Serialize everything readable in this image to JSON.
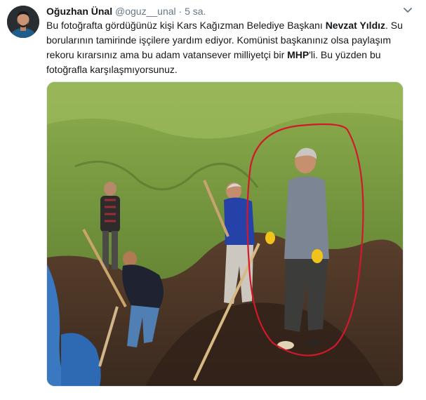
{
  "tweet": {
    "author_name": "Oğuzhan Ünal",
    "author_handle": "@oguz__unal",
    "separator": "·",
    "timestamp": "5 sa.",
    "text_parts": {
      "p1": "Bu fotoğrafta gördüğünüz kişi Kars Kağızman Belediye Başkanı ",
      "b1": "Nevzat Yıldız",
      "p2": ". Su borularının tamirinde işçilere yardım ediyor. Komünist başkanınız olsa paylaşım rekoru kırarsınız ama bu adam vatansever milliyetçi bir ",
      "b2": "MHP",
      "p3": "'li. Bu yüzden bu fotoğrafla karşılaşmıyorsunuz."
    },
    "menu_icon": "chevron-down-icon",
    "avatar_icon": "user-avatar",
    "media_description_icon": "photo"
  },
  "colors": {
    "secondary_text": "#657786",
    "primary_text": "#14171a",
    "circle_annotation": "#d3182b"
  }
}
